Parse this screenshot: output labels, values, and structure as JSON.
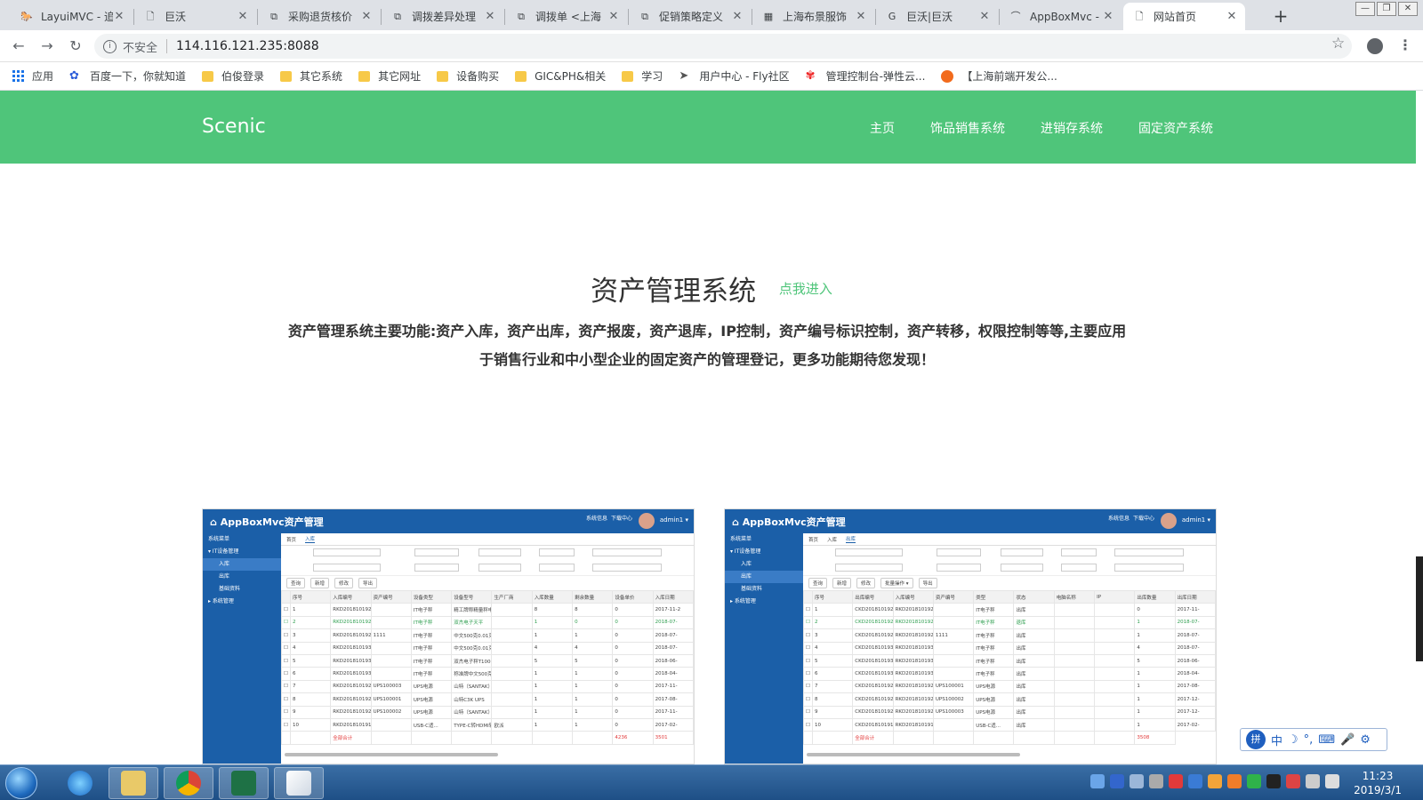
{
  "browser": {
    "tabs": [
      {
        "title": "LayuiMVC - 追",
        "icon": "horse-logo-icon",
        "icon_glyph": "🐎"
      },
      {
        "title": "巨沃",
        "icon": "page-icon",
        "icon_glyph": "🗋"
      },
      {
        "title": "采购退货核价",
        "icon": "puzzle-icon",
        "icon_glyph": "⧉"
      },
      {
        "title": "调拨差异处理",
        "icon": "puzzle-icon",
        "icon_glyph": "⧉"
      },
      {
        "title": "调拨单 <上海",
        "icon": "puzzle-icon",
        "icon_glyph": "⧉"
      },
      {
        "title": "促销策略定义",
        "icon": "puzzle-icon",
        "icon_glyph": "⧉"
      },
      {
        "title": "上海布景服饰",
        "icon": "abvs-logo-icon",
        "icon_glyph": "▦"
      },
      {
        "title": "巨沃|巨沃",
        "icon": "g-logo-icon",
        "icon_glyph": "G"
      },
      {
        "title": "AppBoxMvc -",
        "icon": "appbox-logo-icon",
        "icon_glyph": "⌒"
      },
      {
        "title": "网站首页",
        "icon": "page-icon",
        "icon_glyph": "🗋",
        "active": true
      }
    ],
    "new_tab": "+",
    "window_controls": [
      "—",
      "❐",
      "✕"
    ],
    "security_label": "不安全",
    "url": "114.116.121.235:8088",
    "bookmarks": [
      {
        "label": "应用",
        "icon": "apps-grid-icon"
      },
      {
        "label": "百度一下，你就知道",
        "icon": "baidu-paw-icon"
      },
      {
        "label": "伯俊登录",
        "icon": "folder-icon"
      },
      {
        "label": "其它系统",
        "icon": "folder-icon"
      },
      {
        "label": "其它网址",
        "icon": "folder-icon"
      },
      {
        "label": "设备购买",
        "icon": "folder-icon"
      },
      {
        "label": "GIC&PH&相关",
        "icon": "folder-icon"
      },
      {
        "label": "学习",
        "icon": "folder-icon"
      },
      {
        "label": "用户中心 - Fly社区",
        "icon": "send-icon"
      },
      {
        "label": "管理控制台-弹性云...",
        "icon": "huawei-logo-icon"
      },
      {
        "label": "【上海前端开发公...",
        "icon": "orange-circle-icon"
      }
    ]
  },
  "site": {
    "brand": "Scenic",
    "header_color": "#4fc57a",
    "nav": [
      "主页",
      "饰品销售系统",
      "进销存系统",
      "固定资产系统"
    ],
    "hero": {
      "title": "资产管理系统",
      "enter_link": "点我进入",
      "desc_line1": "资产管理系统主要功能:资产入库，资产出库，资产报废，资产退库，IP控制，资产编号标识控制，资产转移，权限控制等等,主要应用",
      "desc_line2": "于销售行业和中小型企业的固定资产的管理登记，更多功能期待您发现！"
    }
  },
  "screenshots": [
    {
      "app_title": "AppBoxMvc资产管理",
      "user": "admin1 ▾",
      "menu_icons": [
        "系统信息",
        "下载中心"
      ],
      "side": [
        "系统菜单",
        "▾ IT设备管理",
        "入库",
        "出库",
        "基础资料",
        "▸ 系统管理"
      ],
      "active_side": 2,
      "tabs": [
        "首页",
        "入库"
      ],
      "buttons": [
        "查询",
        "新增",
        "修改",
        "导出"
      ],
      "headers": [
        "序号",
        "入库编号",
        "资产编号",
        "设备类型",
        "设备型号",
        "生产厂商",
        "入库数量",
        "剩余数量",
        "设备单价",
        "入库日期"
      ],
      "rows": [
        [
          "1",
          "RKD201810192298",
          "",
          "IT电子秤",
          "精工牌称精量秤电子秤",
          "",
          "8",
          "8",
          "0",
          "2017-11-2"
        ],
        [
          "2",
          "RKD201810192613",
          "",
          "IT电子秤",
          "双杰电子天平",
          "",
          "1",
          "0",
          "0",
          "2018-07-"
        ],
        [
          "3",
          "RKD201810192984",
          "1111",
          "IT电子秤",
          "中文500克0.01克",
          "",
          "1",
          "1",
          "0",
          "2018-07-"
        ],
        [
          "4",
          "RKD201810193015",
          "",
          "IT电子秤",
          "中文500克0.01克",
          "",
          "4",
          "4",
          "0",
          "2018-07-"
        ],
        [
          "5",
          "RKD201810193044",
          "",
          "IT电子秤",
          "双杰电子秤T1000G/0.1G",
          "",
          "5",
          "5",
          "0",
          "2018-06-"
        ],
        [
          "6",
          "RKD201810193045",
          "",
          "IT电子秤",
          "称准牌中文500克0.01克",
          "",
          "1",
          "1",
          "0",
          "2018-04-"
        ],
        [
          "7",
          "RKD201810192571",
          "UPS100003",
          "UPS电源",
          "山特（SANTAK）山特...",
          "",
          "1",
          "1",
          "0",
          "2017-11-"
        ],
        [
          "8",
          "RKD201810192308",
          "UPS100001",
          "UPS电源",
          "山特C3K UPS",
          "",
          "1",
          "1",
          "0",
          "2017-08-"
        ],
        [
          "9",
          "RKD201810192539",
          "UPS100002",
          "UPS电源",
          "山特（SANTAK）山特...",
          "",
          "1",
          "1",
          "0",
          "2017-11-"
        ],
        [
          "10",
          "RKD201810191821",
          "",
          "USB-C适...",
          "TYPE-C转HDMI转接器...",
          "欧派",
          "1",
          "1",
          "0",
          "2017-02-"
        ]
      ],
      "highlight_row": 1,
      "total_label": "全部合计",
      "totals": [
        "4236",
        "3501"
      ]
    },
    {
      "app_title": "AppBoxMvc资产管理",
      "user": "admin1 ▾",
      "menu_icons": [
        "系统信息",
        "下载中心"
      ],
      "side": [
        "系统菜单",
        "▾ IT设备管理",
        "入库",
        "出库",
        "基础资料",
        "▸ 系统管理"
      ],
      "active_side": 3,
      "tabs": [
        "首页",
        "入库",
        "出库"
      ],
      "buttons": [
        "查询",
        "新增",
        "修改",
        "批量操作 ▾",
        "导出"
      ],
      "headers": [
        "序号",
        "出库编号",
        "入库编号",
        "资产编号",
        "类型",
        "状态",
        "电脑名称",
        "IP",
        "出库数量",
        "出库日期"
      ],
      "rows": [
        [
          "1",
          "CKD201810192298",
          "RKD201810192298",
          "",
          "IT电子秤",
          "出库",
          "",
          "",
          "0",
          "2017-11-"
        ],
        [
          "2",
          "CKD201810192613",
          "RKD201810192613",
          "",
          "IT电子秤",
          "退库",
          "",
          "",
          "1",
          "2018-07-"
        ],
        [
          "3",
          "CKD201810192984",
          "RKD201810192984",
          "1111",
          "IT电子秤",
          "出库",
          "",
          "",
          "1",
          "2018-07-"
        ],
        [
          "4",
          "CKD201810193015",
          "RKD201810193015",
          "",
          "IT电子秤",
          "出库",
          "",
          "",
          "4",
          "2018-07-"
        ],
        [
          "5",
          "CKD201810193044",
          "RKD201810193044",
          "",
          "IT电子秤",
          "出库",
          "",
          "",
          "5",
          "2018-06-"
        ],
        [
          "6",
          "CKD201810193045",
          "RKD201810193045",
          "",
          "IT电子秤",
          "出库",
          "",
          "",
          "1",
          "2018-04-"
        ],
        [
          "7",
          "CKD201810192398",
          "RKD201810192398",
          "UPS100001",
          "UPS电源",
          "出库",
          "",
          "",
          "1",
          "2017-08-"
        ],
        [
          "8",
          "CKD201810192550",
          "RKD201810192550",
          "UPS100002",
          "UPS电源",
          "出库",
          "",
          "",
          "1",
          "2017-12-"
        ],
        [
          "9",
          "CKD201810192571",
          "RKD201810192571",
          "UPS100003",
          "UPS电源",
          "出库",
          "",
          "",
          "1",
          "2017-12-"
        ],
        [
          "10",
          "CKD201810191821",
          "RKD201810191821",
          "",
          "USB-C适...",
          "出库",
          "",
          "",
          "1",
          "2017-02-"
        ]
      ],
      "highlight_row": 1,
      "total_label": "全部合计",
      "totals": [
        "3508"
      ]
    }
  ],
  "ime_toolbar": {
    "badge": "拼",
    "items": [
      "中",
      "☽",
      "°,",
      "⌨",
      "🎤",
      "⚙"
    ]
  },
  "taskbar": {
    "apps": [
      "ie-icon",
      "explorer-icon",
      "chrome-icon",
      "excel-icon",
      "paint-icon"
    ],
    "time": "11:23",
    "date": "2019/3/1"
  }
}
